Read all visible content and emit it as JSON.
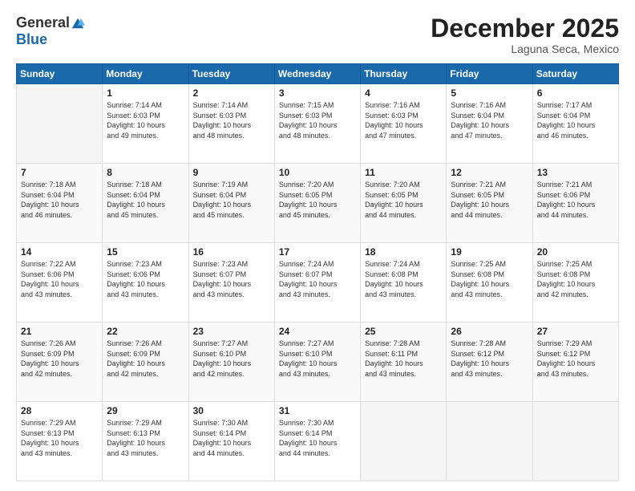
{
  "header": {
    "logo_general": "General",
    "logo_blue": "Blue",
    "month_title": "December 2025",
    "location": "Laguna Seca, Mexico"
  },
  "days_of_week": [
    "Sunday",
    "Monday",
    "Tuesday",
    "Wednesday",
    "Thursday",
    "Friday",
    "Saturday"
  ],
  "weeks": [
    [
      {
        "day": "",
        "info": ""
      },
      {
        "day": "1",
        "info": "Sunrise: 7:14 AM\nSunset: 6:03 PM\nDaylight: 10 hours\nand 49 minutes."
      },
      {
        "day": "2",
        "info": "Sunrise: 7:14 AM\nSunset: 6:03 PM\nDaylight: 10 hours\nand 48 minutes."
      },
      {
        "day": "3",
        "info": "Sunrise: 7:15 AM\nSunset: 6:03 PM\nDaylight: 10 hours\nand 48 minutes."
      },
      {
        "day": "4",
        "info": "Sunrise: 7:16 AM\nSunset: 6:03 PM\nDaylight: 10 hours\nand 47 minutes."
      },
      {
        "day": "5",
        "info": "Sunrise: 7:16 AM\nSunset: 6:04 PM\nDaylight: 10 hours\nand 47 minutes."
      },
      {
        "day": "6",
        "info": "Sunrise: 7:17 AM\nSunset: 6:04 PM\nDaylight: 10 hours\nand 46 minutes."
      }
    ],
    [
      {
        "day": "7",
        "info": "Sunrise: 7:18 AM\nSunset: 6:04 PM\nDaylight: 10 hours\nand 46 minutes."
      },
      {
        "day": "8",
        "info": "Sunrise: 7:18 AM\nSunset: 6:04 PM\nDaylight: 10 hours\nand 45 minutes."
      },
      {
        "day": "9",
        "info": "Sunrise: 7:19 AM\nSunset: 6:04 PM\nDaylight: 10 hours\nand 45 minutes."
      },
      {
        "day": "10",
        "info": "Sunrise: 7:20 AM\nSunset: 6:05 PM\nDaylight: 10 hours\nand 45 minutes."
      },
      {
        "day": "11",
        "info": "Sunrise: 7:20 AM\nSunset: 6:05 PM\nDaylight: 10 hours\nand 44 minutes."
      },
      {
        "day": "12",
        "info": "Sunrise: 7:21 AM\nSunset: 6:05 PM\nDaylight: 10 hours\nand 44 minutes."
      },
      {
        "day": "13",
        "info": "Sunrise: 7:21 AM\nSunset: 6:06 PM\nDaylight: 10 hours\nand 44 minutes."
      }
    ],
    [
      {
        "day": "14",
        "info": "Sunrise: 7:22 AM\nSunset: 6:06 PM\nDaylight: 10 hours\nand 43 minutes."
      },
      {
        "day": "15",
        "info": "Sunrise: 7:23 AM\nSunset: 6:06 PM\nDaylight: 10 hours\nand 43 minutes."
      },
      {
        "day": "16",
        "info": "Sunrise: 7:23 AM\nSunset: 6:07 PM\nDaylight: 10 hours\nand 43 minutes."
      },
      {
        "day": "17",
        "info": "Sunrise: 7:24 AM\nSunset: 6:07 PM\nDaylight: 10 hours\nand 43 minutes."
      },
      {
        "day": "18",
        "info": "Sunrise: 7:24 AM\nSunset: 6:08 PM\nDaylight: 10 hours\nand 43 minutes."
      },
      {
        "day": "19",
        "info": "Sunrise: 7:25 AM\nSunset: 6:08 PM\nDaylight: 10 hours\nand 43 minutes."
      },
      {
        "day": "20",
        "info": "Sunrise: 7:25 AM\nSunset: 6:08 PM\nDaylight: 10 hours\nand 42 minutes."
      }
    ],
    [
      {
        "day": "21",
        "info": "Sunrise: 7:26 AM\nSunset: 6:09 PM\nDaylight: 10 hours\nand 42 minutes."
      },
      {
        "day": "22",
        "info": "Sunrise: 7:26 AM\nSunset: 6:09 PM\nDaylight: 10 hours\nand 42 minutes."
      },
      {
        "day": "23",
        "info": "Sunrise: 7:27 AM\nSunset: 6:10 PM\nDaylight: 10 hours\nand 42 minutes."
      },
      {
        "day": "24",
        "info": "Sunrise: 7:27 AM\nSunset: 6:10 PM\nDaylight: 10 hours\nand 43 minutes."
      },
      {
        "day": "25",
        "info": "Sunrise: 7:28 AM\nSunset: 6:11 PM\nDaylight: 10 hours\nand 43 minutes."
      },
      {
        "day": "26",
        "info": "Sunrise: 7:28 AM\nSunset: 6:12 PM\nDaylight: 10 hours\nand 43 minutes."
      },
      {
        "day": "27",
        "info": "Sunrise: 7:29 AM\nSunset: 6:12 PM\nDaylight: 10 hours\nand 43 minutes."
      }
    ],
    [
      {
        "day": "28",
        "info": "Sunrise: 7:29 AM\nSunset: 6:13 PM\nDaylight: 10 hours\nand 43 minutes."
      },
      {
        "day": "29",
        "info": "Sunrise: 7:29 AM\nSunset: 6:13 PM\nDaylight: 10 hours\nand 43 minutes."
      },
      {
        "day": "30",
        "info": "Sunrise: 7:30 AM\nSunset: 6:14 PM\nDaylight: 10 hours\nand 44 minutes."
      },
      {
        "day": "31",
        "info": "Sunrise: 7:30 AM\nSunset: 6:14 PM\nDaylight: 10 hours\nand 44 minutes."
      },
      {
        "day": "",
        "info": ""
      },
      {
        "day": "",
        "info": ""
      },
      {
        "day": "",
        "info": ""
      }
    ]
  ]
}
